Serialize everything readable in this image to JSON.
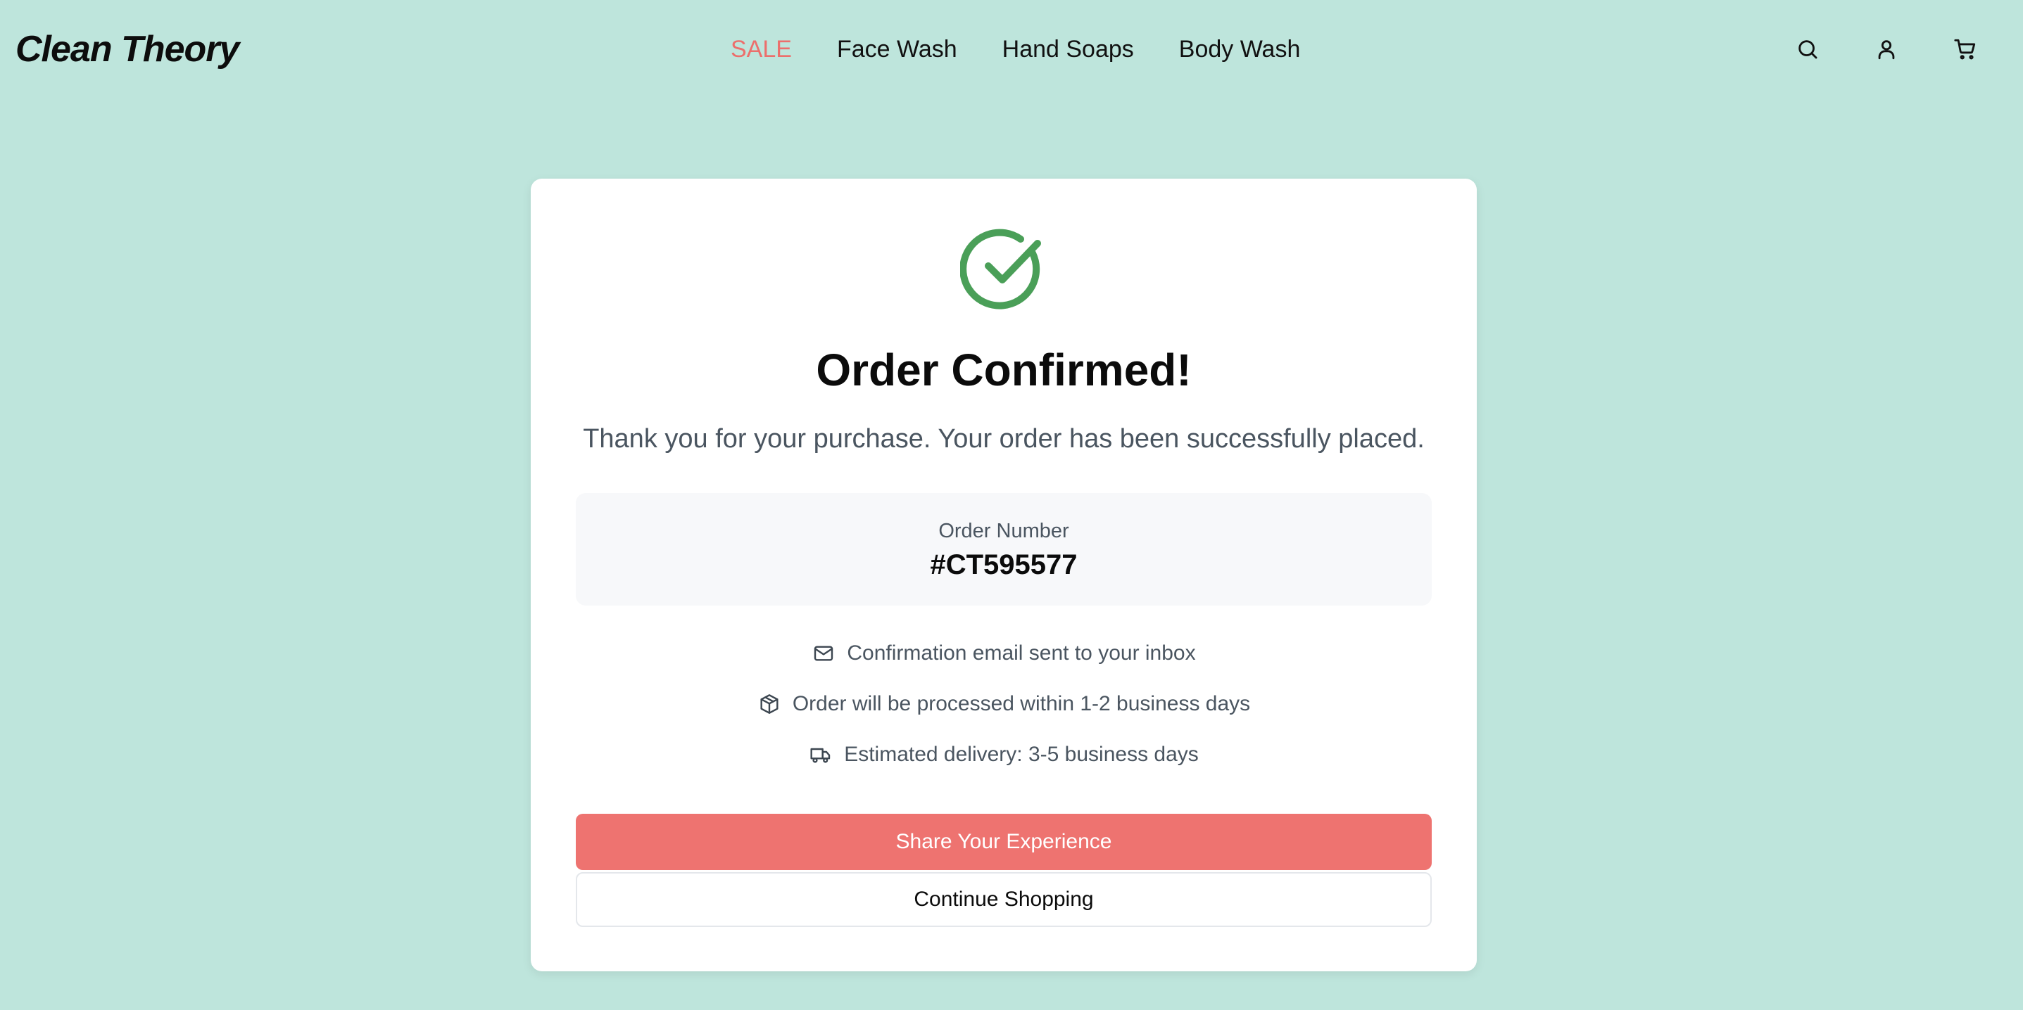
{
  "brand": {
    "name": "Clean Theory"
  },
  "nav": {
    "items": [
      {
        "label": "SALE",
        "highlight": true
      },
      {
        "label": "Face Wash",
        "highlight": false
      },
      {
        "label": "Hand Soaps",
        "highlight": false
      },
      {
        "label": "Body Wash",
        "highlight": false
      }
    ]
  },
  "header_icons": [
    "search-icon",
    "account-icon",
    "cart-icon"
  ],
  "confirmation": {
    "title": "Order Confirmed!",
    "message": "Thank you for your purchase. Your order has been successfully placed.",
    "order_label": "Order Number",
    "order_number": "#CT595577",
    "info": [
      {
        "icon": "mail-icon",
        "text": "Confirmation email sent to your inbox"
      },
      {
        "icon": "package-icon",
        "text": "Order will be processed within 1-2 business days"
      },
      {
        "icon": "truck-icon",
        "text": "Estimated delivery: 3-5 business days"
      }
    ],
    "primary_button": "Share Your Experience",
    "secondary_button": "Continue Shopping"
  },
  "colors": {
    "background": "#bee5dc",
    "accent": "#ee7370",
    "sale": "#ec6f6c",
    "success": "#4a9f58"
  }
}
